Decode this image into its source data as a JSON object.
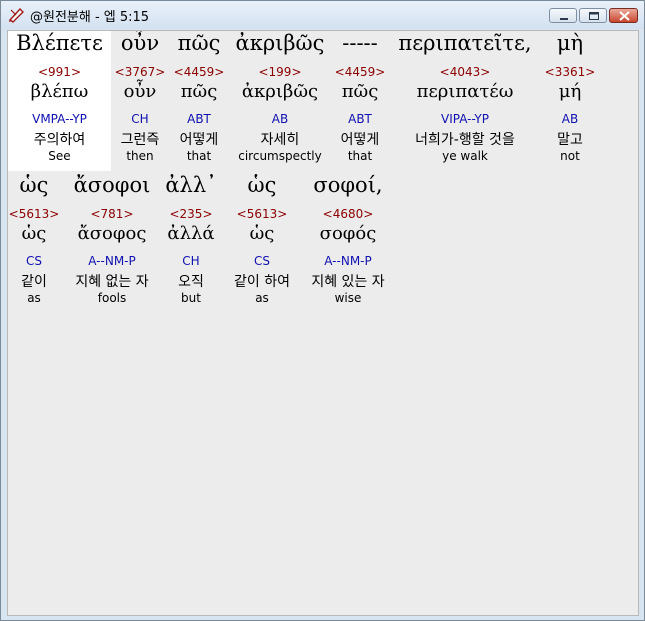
{
  "window": {
    "title": "@원전분해 - 엡 5:15"
  },
  "lines": [
    {
      "words": [
        {
          "greek": "Βλέπετε",
          "strong": "<991>",
          "lemma": "βλέπω",
          "parse": "VMPA--YP",
          "korean": "주의하여",
          "english": "See",
          "highlighted": true
        },
        {
          "greek": "οὖν",
          "strong": "<3767>",
          "lemma": "οὖν",
          "parse": "CH",
          "korean": "그런즉",
          "english": "then"
        },
        {
          "greek": "πῶς",
          "strong": "<4459>",
          "lemma": "πῶς",
          "parse": "ABT",
          "korean": "어떻게",
          "english": "that"
        },
        {
          "greek": "ἀκριβῶς",
          "strong": "<199>",
          "lemma": "ἀκριβῶς",
          "parse": "AB",
          "korean": "자세히",
          "english": "circumspectly"
        },
        {
          "greek": "-----",
          "strong": "<4459>",
          "lemma": "πῶς",
          "parse": "ABT",
          "korean": "어떻게",
          "english": "that"
        },
        {
          "greek": "περιπατεῖτε,",
          "strong": "<4043>",
          "lemma": "περιπατέω",
          "parse": "VIPA--YP",
          "korean": "너희가-행할 것을",
          "english": "ye walk"
        },
        {
          "greek": "μὴ",
          "strong": "<3361>",
          "lemma": "μή",
          "parse": "AB",
          "korean": "말고",
          "english": "not"
        }
      ]
    },
    {
      "words": [
        {
          "greek": "ὡς",
          "strong": "<5613>",
          "lemma": "ὡς",
          "parse": "CS",
          "korean": "같이",
          "english": "as"
        },
        {
          "greek": "ἄσοφοι",
          "strong": "<781>",
          "lemma": "ἄσοφος",
          "parse": "A--NM-P",
          "korean": "지혜 없는 자",
          "english": "fools"
        },
        {
          "greek": "ἀλλ᾽",
          "strong": "<235>",
          "lemma": "ἀλλά",
          "parse": "CH",
          "korean": "오직",
          "english": "but"
        },
        {
          "greek": "ὡς",
          "strong": "<5613>",
          "lemma": "ὡς",
          "parse": "CS",
          "korean": "같이 하여",
          "english": "as"
        },
        {
          "greek": "σοφοί,",
          "strong": "<4680>",
          "lemma": "σοφός",
          "parse": "A--NM-P",
          "korean": "지혜 있는 자",
          "english": "wise"
        }
      ]
    }
  ]
}
